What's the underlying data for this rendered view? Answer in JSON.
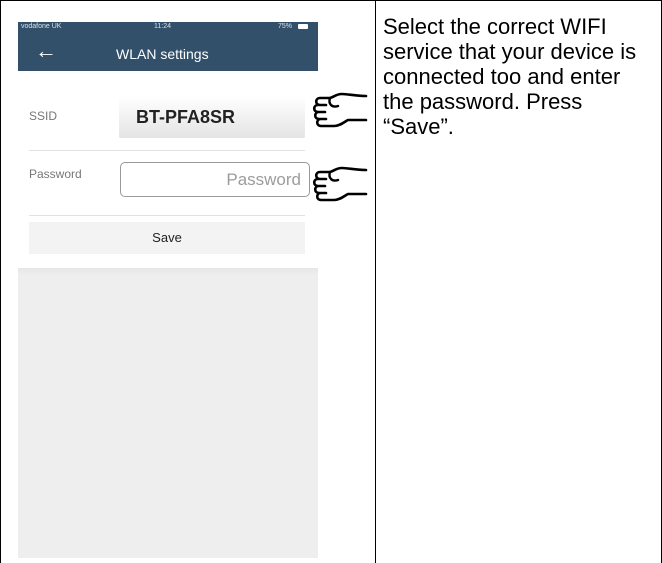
{
  "status_bar": {
    "carrier": "vodafone UK",
    "time": "11:24",
    "battery": "75%"
  },
  "header": {
    "title": "WLAN settings"
  },
  "ssid": {
    "label": "SSID",
    "value": "BT-PFA8SR"
  },
  "password": {
    "label": "Password",
    "placeholder": "Password",
    "value": ""
  },
  "save_label": "Save",
  "instruction": "Select the correct WIFI service that your device is connected too and enter the password. Press “Save”.",
  "colors": {
    "header_bg": "#33506b",
    "page_bg": "#eeeeee"
  }
}
